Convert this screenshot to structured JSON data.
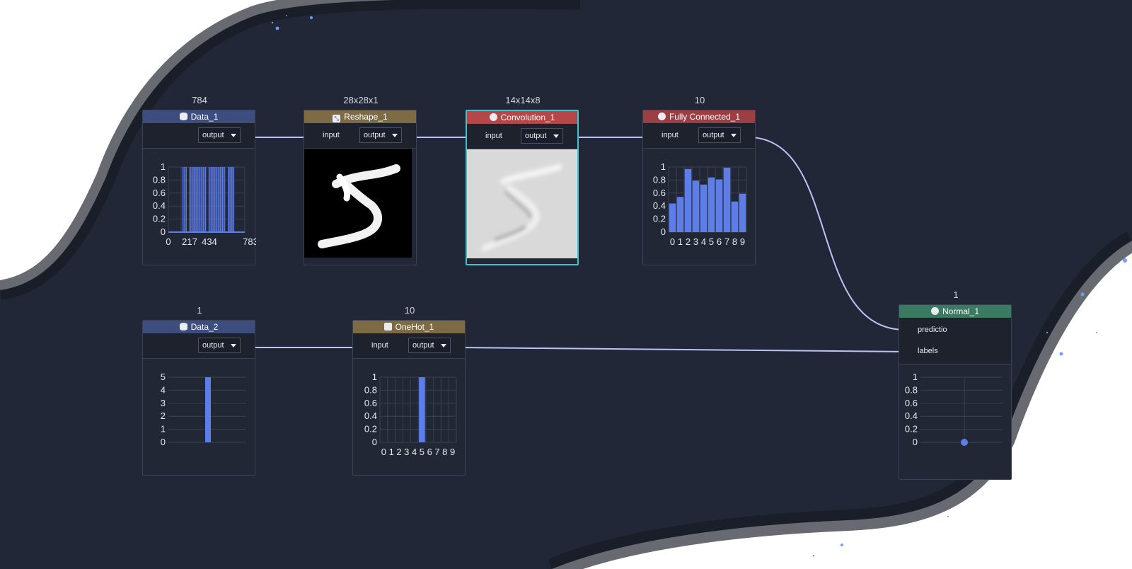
{
  "colors": {
    "canvas": "#212736",
    "background": "#ffffff",
    "wire": "#b9c4f5",
    "bar": "#5d7de8",
    "header_data": "#3c4d7e",
    "header_reshape": "#7d6b45",
    "header_convolution": "#b54748",
    "header_fully_connected": "#9b3f44",
    "header_onehot": "#7d6b45",
    "header_normal": "#3a7a60",
    "selected_border": "#3fc4cf"
  },
  "nodes": {
    "data_1": {
      "shape": "784",
      "title": "Data_1",
      "icon": "database-icon",
      "output": "output",
      "chart": {
        "type": "bar",
        "y_ticks": [
          "1",
          "0.8",
          "0.6",
          "0.4",
          "0.2",
          "0"
        ],
        "x_ticks": [
          "0",
          "217",
          "434",
          "783"
        ]
      }
    },
    "reshape_1": {
      "shape": "28x28x1",
      "title": "Reshape_1",
      "icon": "resize-icon",
      "input": "input",
      "output": "output",
      "image": "digit-5-image"
    },
    "convolution_1": {
      "shape": "14x14x8",
      "title": "Convolution_1",
      "icon": "convolution-icon",
      "input": "input",
      "output": "output",
      "image": "feature-map-image"
    },
    "fully_connected_1": {
      "shape": "10",
      "title": "Fully Connected_1",
      "icon": "circle-icon",
      "input": "input",
      "output": "output",
      "chart": {
        "type": "bar",
        "y_ticks": [
          "1",
          "0.8",
          "0.6",
          "0.4",
          "0.2",
          "0"
        ],
        "x_ticks": [
          "0",
          "1",
          "2",
          "3",
          "4",
          "5",
          "6",
          "7",
          "8",
          "9"
        ],
        "values": [
          0.44,
          0.54,
          0.97,
          0.79,
          0.73,
          0.84,
          0.81,
          0.99,
          0.47,
          0.59
        ],
        "ylim": [
          0,
          1
        ]
      }
    },
    "data_2": {
      "shape": "1",
      "title": "Data_2",
      "icon": "database-icon",
      "output": "output",
      "chart": {
        "type": "bar",
        "y_ticks": [
          "5",
          "4",
          "3",
          "2",
          "1",
          "0"
        ],
        "values": [
          5
        ],
        "ylim": [
          0,
          5
        ]
      }
    },
    "onehot_1": {
      "shape": "10",
      "title": "OneHot_1",
      "icon": "onehot-icon",
      "input": "input",
      "output": "output",
      "chart": {
        "type": "bar",
        "y_ticks": [
          "1",
          "0.8",
          "0.6",
          "0.4",
          "0.2",
          "0"
        ],
        "x_ticks": [
          "0",
          "1",
          "2",
          "3",
          "4",
          "5",
          "6",
          "7",
          "8",
          "9"
        ],
        "values": [
          0,
          0,
          0,
          0,
          0,
          1,
          0,
          0,
          0,
          0
        ],
        "ylim": [
          0,
          1
        ]
      }
    },
    "normal_1": {
      "shape": "1",
      "title": "Normal_1",
      "icon": "gear-icon",
      "inputs": [
        "predictio",
        "labels"
      ],
      "chart": {
        "type": "scatter",
        "y_ticks": [
          "1",
          "0.8",
          "0.6",
          "0.4",
          "0.2",
          "0"
        ],
        "values": [
          0
        ],
        "ylim": [
          0,
          1
        ]
      }
    }
  }
}
